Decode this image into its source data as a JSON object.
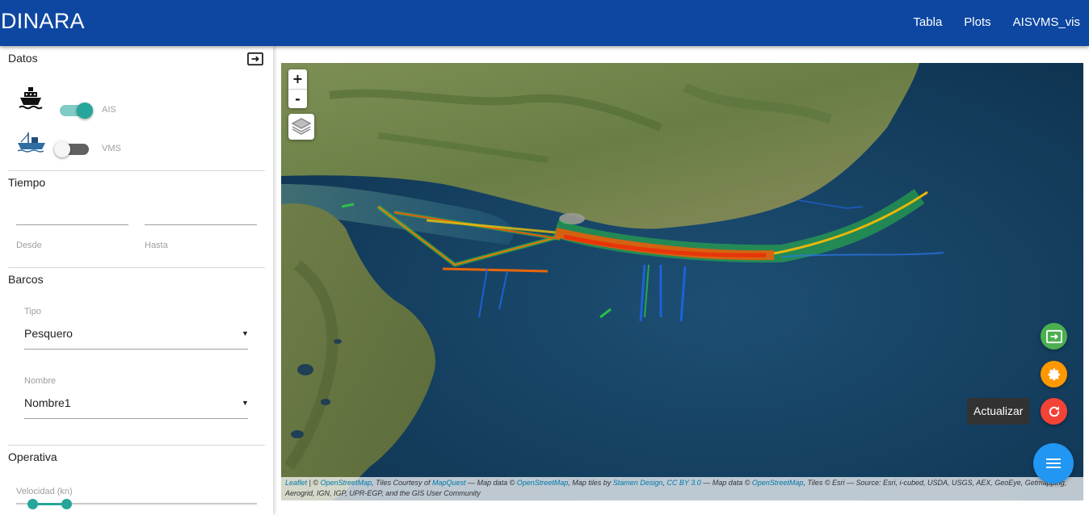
{
  "app": {
    "title": "DINARA"
  },
  "nav": {
    "items": [
      "Tabla",
      "Plots",
      "AISVMS_vis"
    ]
  },
  "sidebar": {
    "datos": {
      "title": "Datos",
      "ais": {
        "label": "AIS",
        "enabled": true,
        "icon": "cruise-ship-icon"
      },
      "vms": {
        "label": "VMS",
        "enabled": false,
        "icon": "fishing-boat-icon"
      }
    },
    "tiempo": {
      "title": "Tiempo",
      "desde": {
        "label": "Desde",
        "value": ""
      },
      "hasta": {
        "label": "Hasta",
        "value": ""
      }
    },
    "barcos": {
      "title": "Barcos",
      "tipo": {
        "label": "Tipo",
        "value": "Pesquero"
      },
      "nombre": {
        "label": "Nombre",
        "value": "Nombre1"
      }
    },
    "operativa": {
      "title": "Operativa",
      "velocidad": {
        "label": "Velocidad (kn)",
        "range": [
          0.07,
          0.21
        ]
      }
    }
  },
  "map": {
    "zoom_in": "+",
    "zoom_out": "-",
    "attribution": {
      "leaflet": "Leaflet",
      "t1": " | © ",
      "osm1": "OpenStreetMap",
      "t2": ", Tiles Courtesy of ",
      "mapquest": "MapQuest",
      "t3": " — Map data © ",
      "osm2": "OpenStreetMap",
      "t4": ", Map tiles by ",
      "stamen": "Stamen Design",
      "t5": ", ",
      "ccby": "CC BY 3.0",
      "t6": " — Map data © ",
      "osm3": "OpenStreetMap",
      "t7": ", Tiles © Esri — Source: Esri, i-cubed, USDA, USGS, AEX, GeoEye, Getmapping, Aerogrid, IGN, IGP, UPR-EGP, and the GIS User Community"
    }
  },
  "fabs": {
    "tooltip": "Actualizar",
    "colors": {
      "login": "#4caf50",
      "settings": "#ff9800",
      "refresh": "#f44336",
      "menu": "#2196f3"
    }
  }
}
